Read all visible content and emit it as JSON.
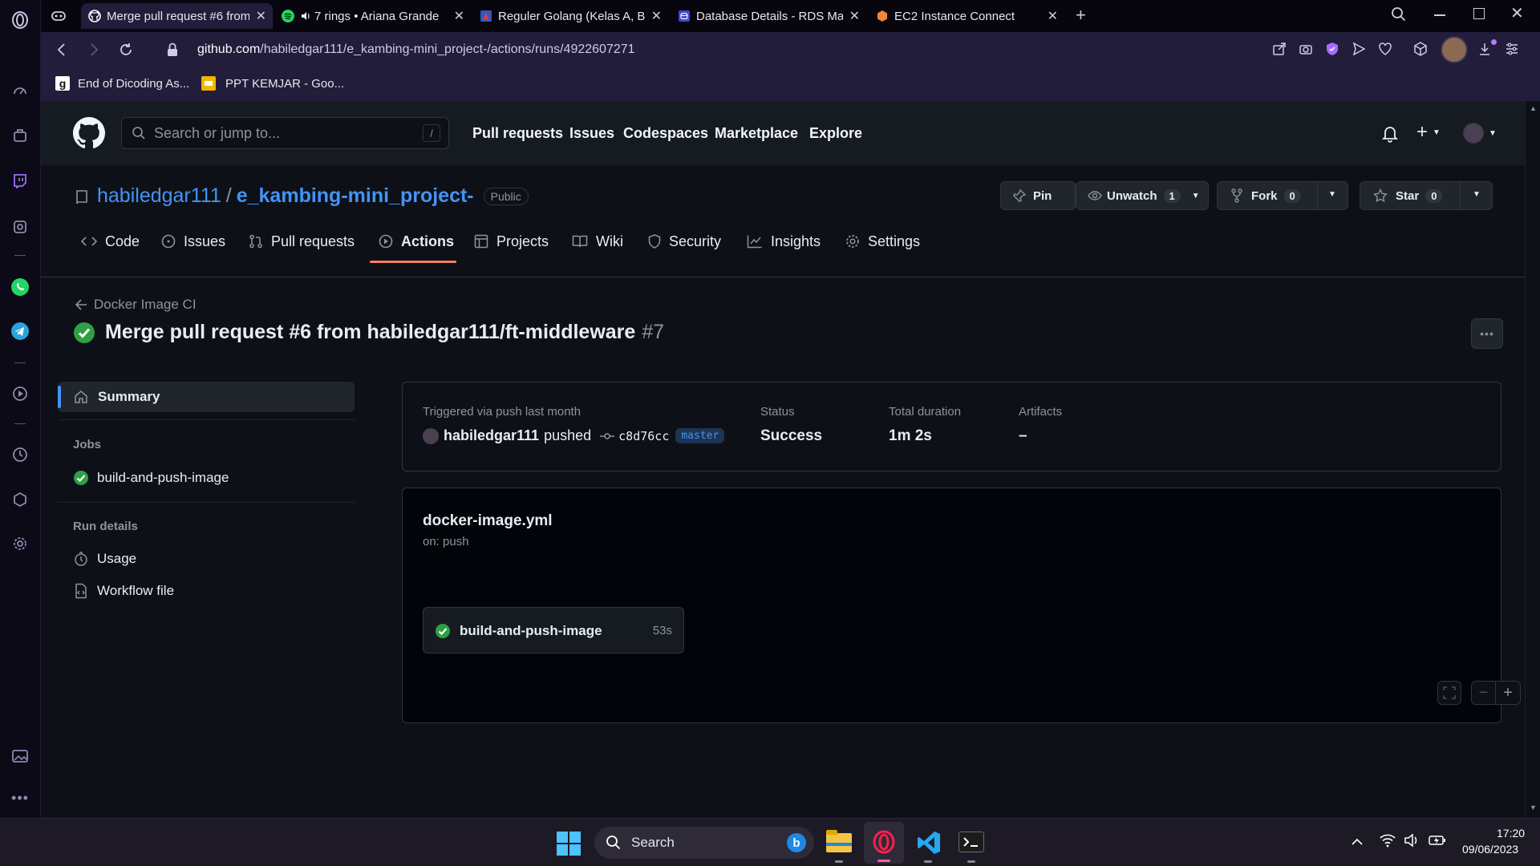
{
  "browser": {
    "tabs": [
      {
        "label": "Merge pull request #6 from",
        "active": true
      },
      {
        "label": "7 rings • Ariana Grande",
        "active": false
      },
      {
        "label": "Reguler Golang (Kelas A, B,",
        "active": false
      },
      {
        "label": "Database Details - RDS Ma",
        "active": false
      },
      {
        "label": "EC2 Instance Connect",
        "active": false
      }
    ],
    "url_host": "github.com",
    "url_path": "/habiledgar111/e_kambing-mini_project-/actions/runs/4922607271",
    "bookmarks": [
      "End of Dicoding As...",
      "PPT KEMJAR - Goo..."
    ]
  },
  "github": {
    "search_placeholder": "Search or jump to...",
    "search_shortcut": "/",
    "nav": [
      "Pull requests",
      "Issues",
      "Codespaces",
      "Marketplace",
      "Explore"
    ],
    "repo": {
      "owner": "habiledgar111",
      "separator": "/",
      "name": "e_kambing-mini_project-",
      "visibility": "Public",
      "pin_label": "Pin",
      "watch_label": "Unwatch",
      "watch_count": "1",
      "fork_label": "Fork",
      "fork_count": "0",
      "star_label": "Star",
      "star_count": "0"
    },
    "tabs": [
      "Code",
      "Issues",
      "Pull requests",
      "Actions",
      "Projects",
      "Wiki",
      "Security",
      "Insights",
      "Settings"
    ],
    "active_tab": "Actions"
  },
  "run": {
    "back_label": "Docker Image CI",
    "title": "Merge pull request #6 from habiledgar111/ft-middleware",
    "number": "#7",
    "sidebar": {
      "summary": "Summary",
      "jobs_heading": "Jobs",
      "job": "build-and-push-image",
      "run_details_heading": "Run details",
      "usage": "Usage",
      "workflow_file": "Workflow file"
    },
    "summary": {
      "trigger_label": "Triggered via push last month",
      "actor": "habiledgar111",
      "action": "pushed",
      "commit": "c8d76cc",
      "branch": "master",
      "status_label": "Status",
      "status_value": "Success",
      "duration_label": "Total duration",
      "duration_value": "1m 2s",
      "artifacts_label": "Artifacts",
      "artifacts_value": "–"
    },
    "workflow": {
      "file": "docker-image.yml",
      "trigger": "on: push",
      "job_name": "build-and-push-image",
      "job_duration": "53s"
    }
  },
  "taskbar": {
    "search_label": "Search",
    "time": "17:20",
    "date": "09/06/2023"
  },
  "colors": {
    "accent_link": "#4493f8",
    "success": "#2ea043",
    "tab_underline": "#f78166",
    "opera_bg": "#211d3a"
  }
}
